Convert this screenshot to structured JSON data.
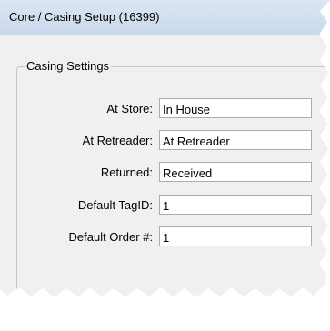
{
  "window": {
    "title": "Core / Casing Setup (16399)"
  },
  "casing_settings": {
    "legend": "Casing Settings",
    "fields": [
      {
        "label": "At Store:",
        "value": "In House"
      },
      {
        "label": "At Retreader:",
        "value": "At Retreader"
      },
      {
        "label": "Returned:",
        "value": "Received"
      },
      {
        "label": "Default TagID:",
        "value": "1"
      },
      {
        "label": "Default Order #:",
        "value": "1"
      }
    ]
  }
}
